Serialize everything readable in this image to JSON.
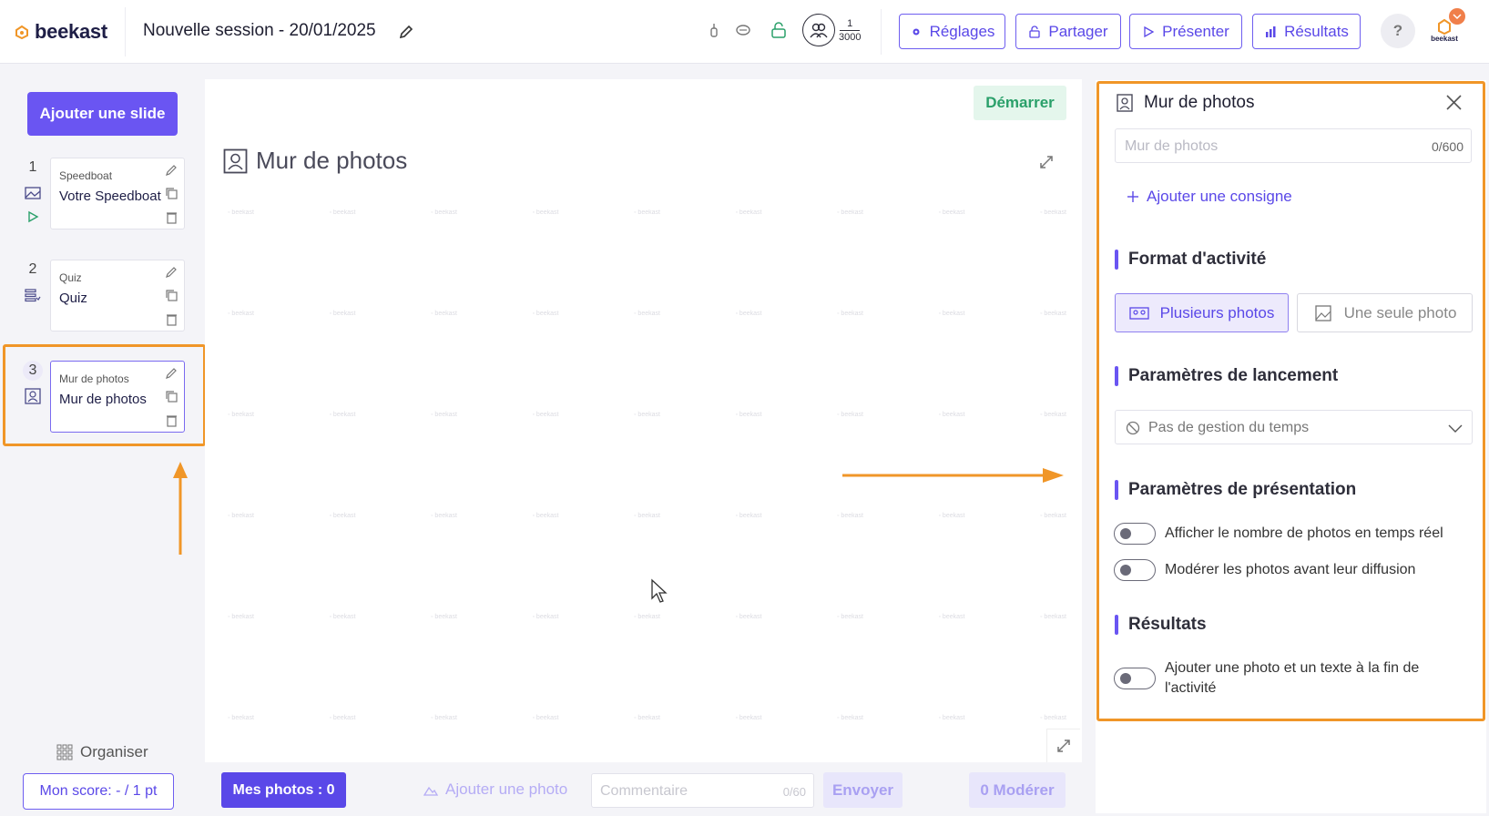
{
  "app": {
    "logo_text": "beekast",
    "session_title": "Nouvelle session - 20/01/2025"
  },
  "header": {
    "participants": {
      "current": "1",
      "max": "3000"
    },
    "buttons": {
      "settings": "Réglages",
      "share": "Partager",
      "present": "Présenter",
      "results": "Résultats"
    },
    "help": "?",
    "avatar_label": "beekast"
  },
  "sidebar": {
    "add_slide": "Ajouter une slide",
    "slides": [
      {
        "number": "1",
        "type": "Speedboat",
        "name": "Votre Speedboat"
      },
      {
        "number": "2",
        "type": "Quiz",
        "name": "Quiz"
      },
      {
        "number": "3",
        "type": "Mur de photos",
        "name": "Mur de photos"
      }
    ],
    "organiser": "Organiser",
    "score": "Mon score: - / 1 pt"
  },
  "canvas": {
    "start_button": "Démarrer",
    "title": "Mur de photos",
    "watermark": "beekast"
  },
  "bottom_bar": {
    "my_photos": "Mes photos : 0",
    "add_photo": "Ajouter une photo",
    "comment_placeholder": "Commentaire",
    "comment_count": "0/60",
    "send": "Envoyer",
    "moderate": "0 Modérer"
  },
  "panel": {
    "title": "Mur de photos",
    "title_input_placeholder": "Mur de photos",
    "title_input_count": "0/600",
    "add_instruction": "Ajouter une consigne",
    "format_heading": "Format d'activité",
    "format_options": {
      "multi": "Plusieurs photos",
      "single": "Une seule photo"
    },
    "format_selected": "multi",
    "launch_heading": "Paramètres de lancement",
    "time_select": "Pas de gestion du temps",
    "presentation_heading": "Paramètres de présentation",
    "presentation_toggles": [
      {
        "label": "Afficher le nombre de photos en temps réel",
        "on": false
      },
      {
        "label": "Modérer les photos avant leur diffusion",
        "on": false
      }
    ],
    "results_heading": "Résultats",
    "results_toggle": {
      "label": "Ajouter une photo et un texte à la fin de l'activité",
      "on": false
    }
  },
  "colors": {
    "accent": "#6a55f2",
    "highlight": "#f09628",
    "start_green": "#2aa06a"
  }
}
